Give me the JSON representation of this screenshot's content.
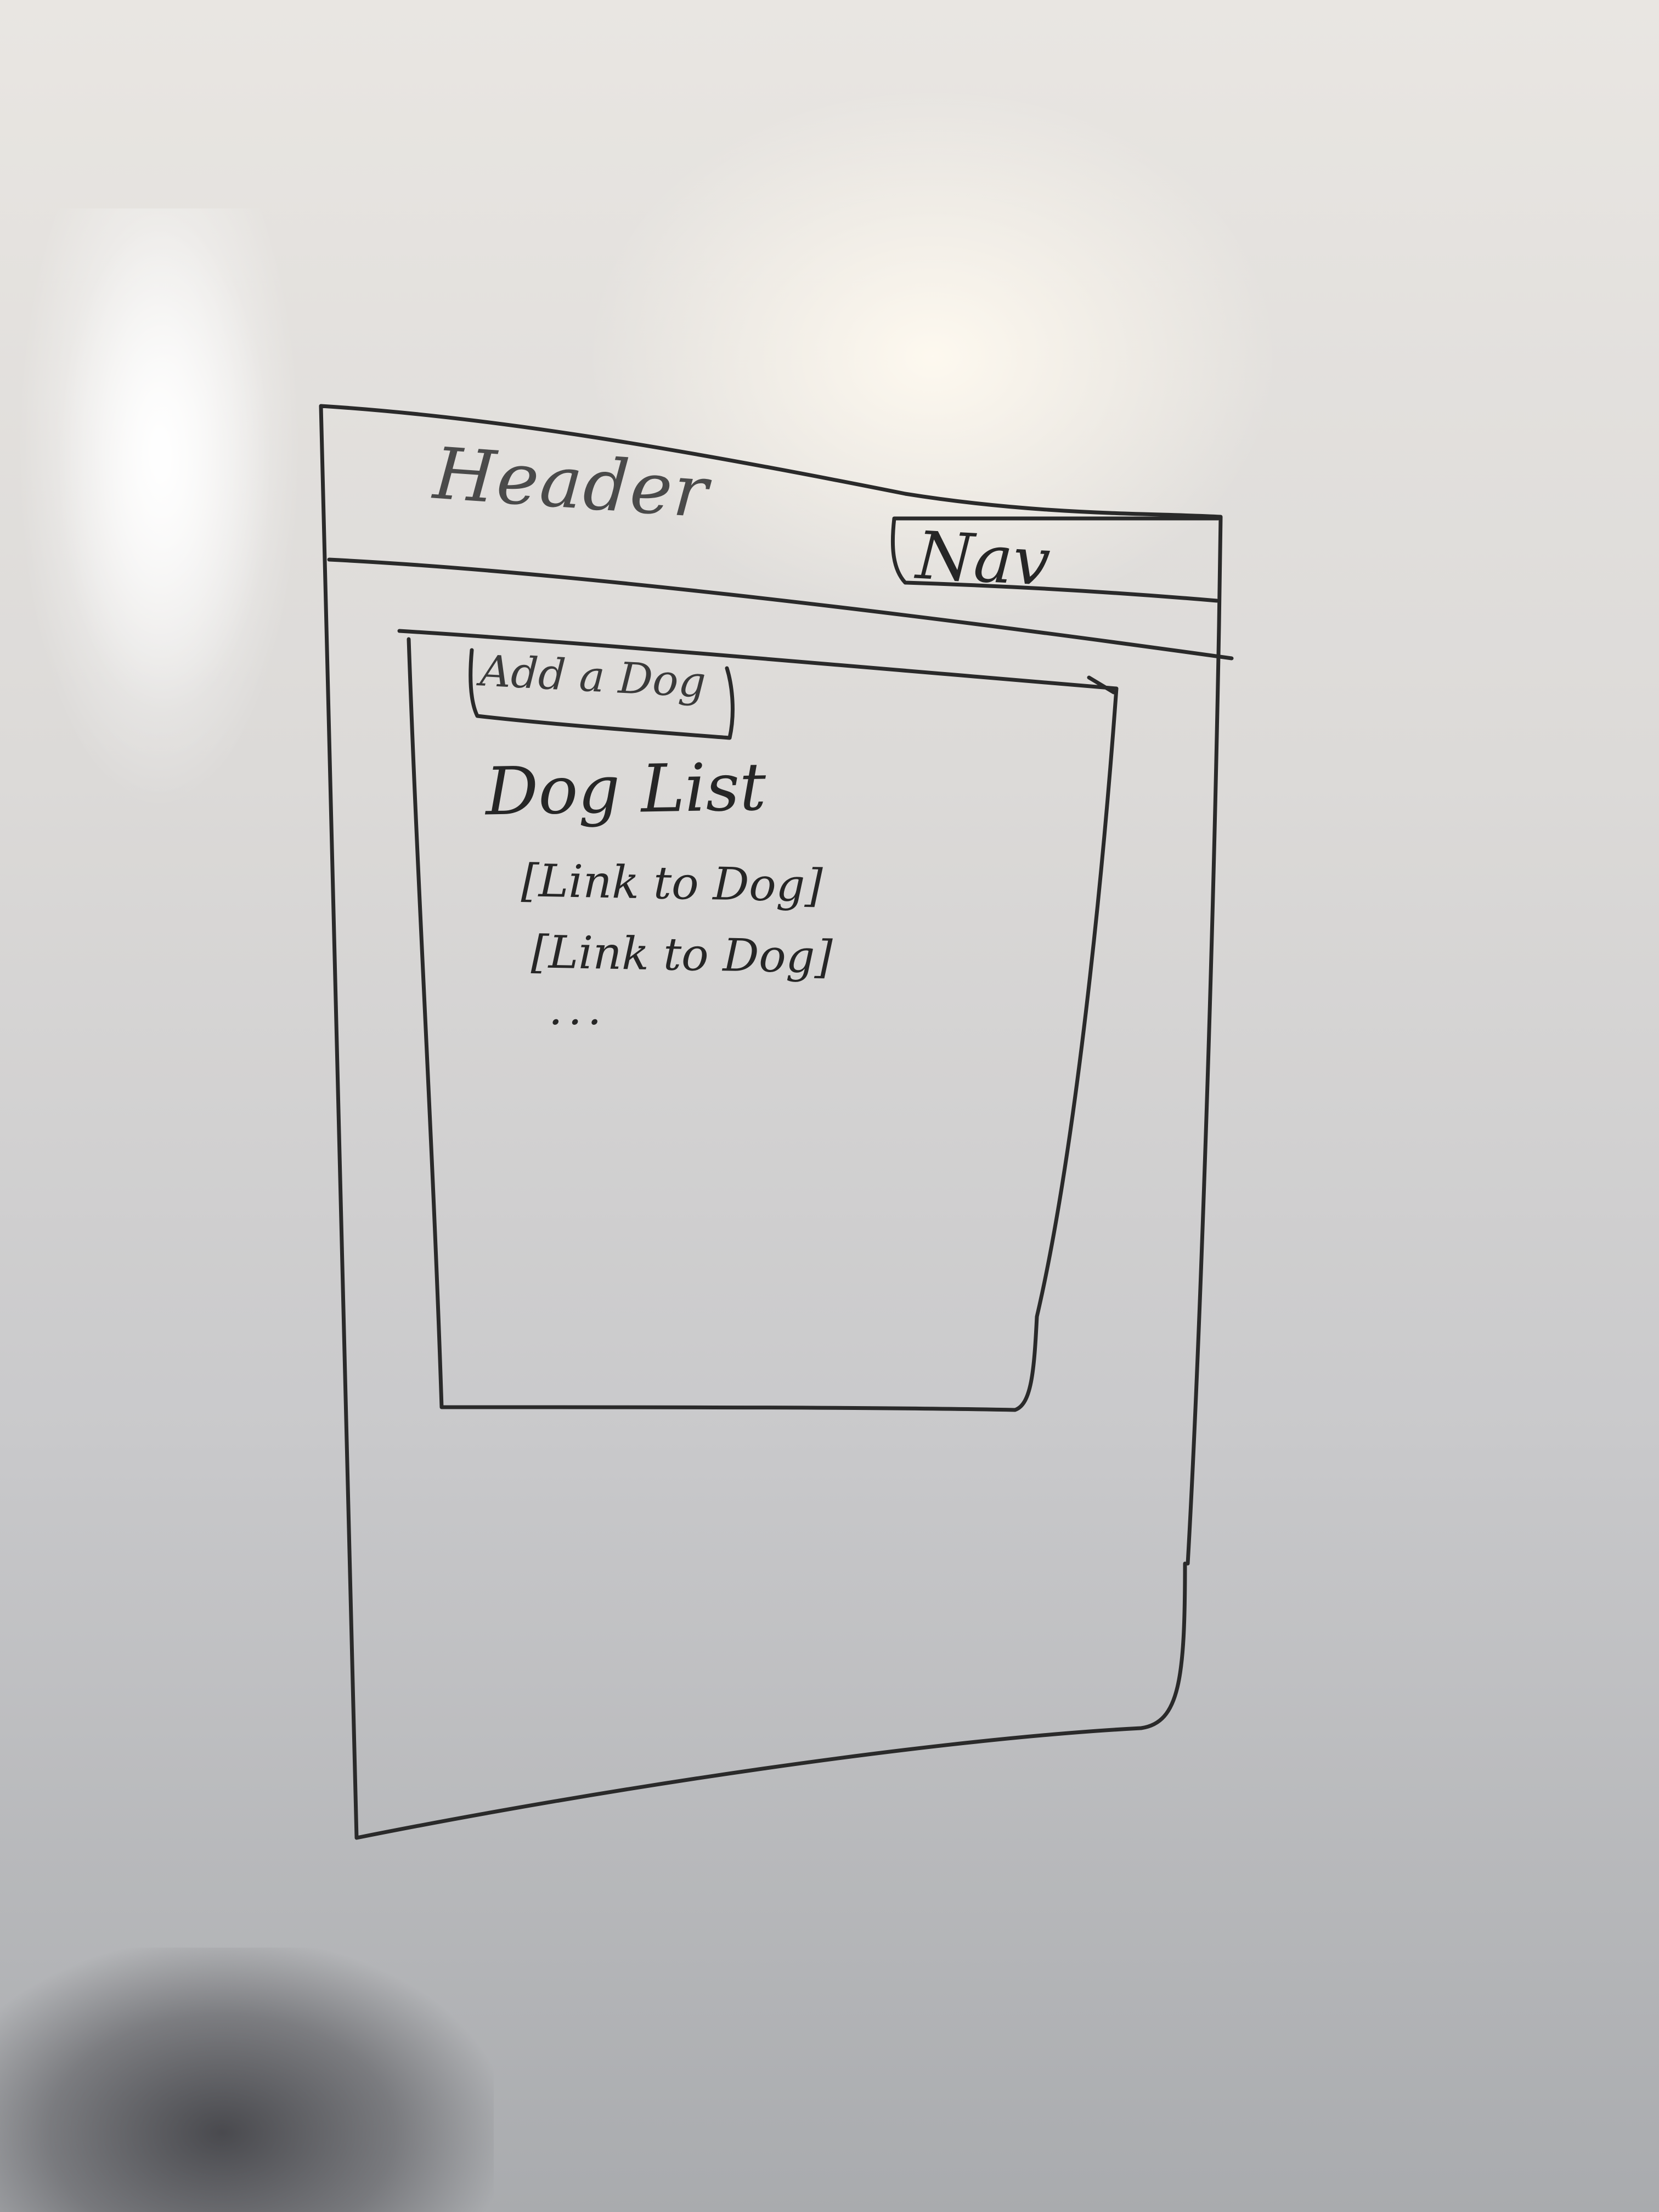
{
  "wireframe": {
    "header": {
      "label": "Header",
      "nav_label": "Nav"
    },
    "content": {
      "add_button_label": "Add a Dog",
      "list_title": "Dog List",
      "list_items": [
        "[Link to Dog]",
        "[Link to Dog]"
      ],
      "more_indicator": "..."
    }
  }
}
